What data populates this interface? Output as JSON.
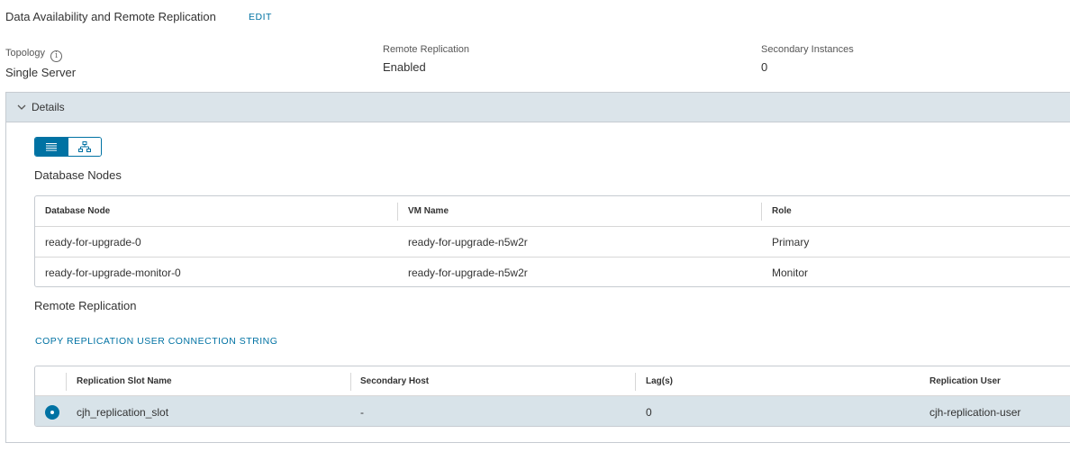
{
  "header": {
    "title": "Data Availability and Remote Replication",
    "edit_label": "EDIT"
  },
  "summary": {
    "topology_label": "Topology",
    "topology_value": "Single Server",
    "remote_replication_label": "Remote Replication",
    "remote_replication_value": "Enabled",
    "secondary_instances_label": "Secondary Instances",
    "secondary_instances_value": "0"
  },
  "details": {
    "label": "Details",
    "expanded": true,
    "view_toggle": {
      "active": "list-view"
    }
  },
  "database_nodes": {
    "title": "Database Nodes",
    "columns": [
      "Database Node",
      "VM Name",
      "Role"
    ],
    "rows": [
      [
        "ready-for-upgrade-0",
        "ready-for-upgrade-n5w2r",
        "Primary"
      ],
      [
        "ready-for-upgrade-monitor-0",
        "ready-for-upgrade-n5w2r",
        "Monitor"
      ]
    ]
  },
  "remote_replication": {
    "title": "Remote Replication",
    "copy_label": "COPY REPLICATION USER CONNECTION STRING",
    "columns": [
      "Replication Slot Name",
      "Secondary Host",
      "Lag(s)",
      "Replication User"
    ],
    "rows": [
      [
        "cjh_replication_slot",
        "-",
        "0",
        "cjh-replication-user"
      ]
    ],
    "selected_row": 0
  },
  "colors": {
    "accent": "#0072a3",
    "header_bg": "#dbe4ea",
    "selected_row_bg": "#d8e3e9"
  }
}
